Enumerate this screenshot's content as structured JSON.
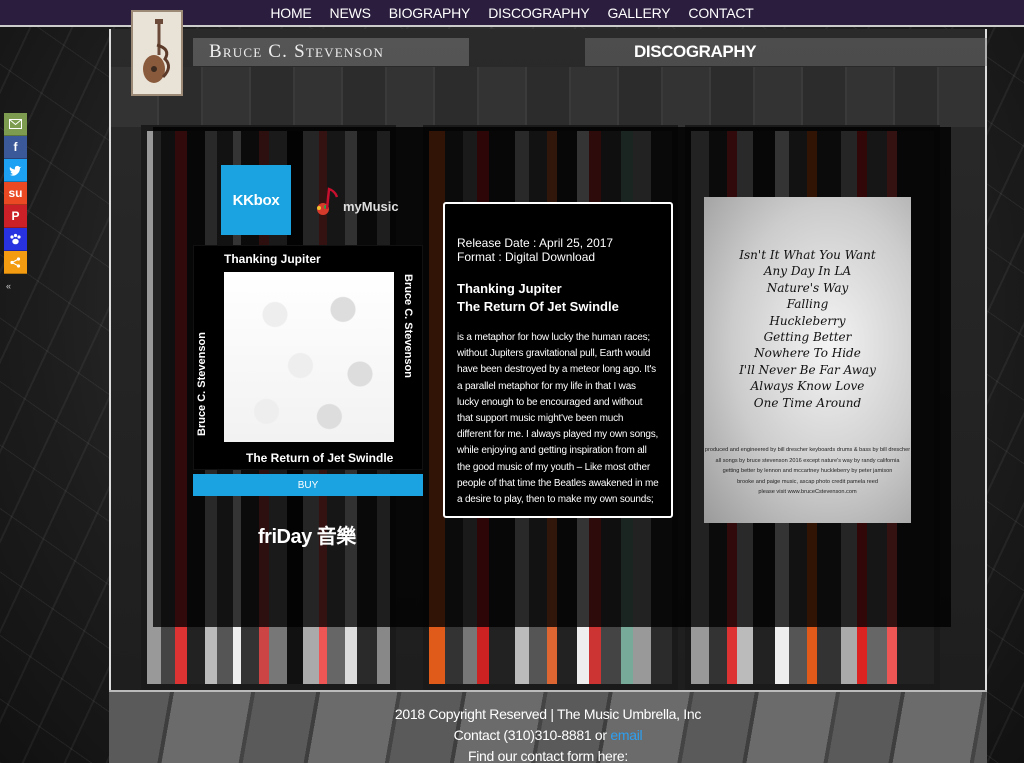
{
  "nav": {
    "items": [
      "HOME",
      "NEWS",
      "BIOGRAPHY",
      "DISCOGRAPHY",
      "GALLERY",
      "CONTACT"
    ]
  },
  "header": {
    "site_title": "Bruce C. Stevenson",
    "section_title": "DISCOGRAPHY"
  },
  "social": {
    "icons": [
      "email-icon",
      "facebook-icon",
      "twitter-icon",
      "stumbleupon-icon",
      "pinterest-icon",
      "paw-icon",
      "more-icon"
    ],
    "collapse_glyph": "«"
  },
  "left": {
    "kkbox_label": "KKbox",
    "mymusic_label": "myMusic",
    "album": {
      "title": "Thanking Jupiter",
      "subtitle": "The Return of Jet Swindle",
      "artist": "Bruce C. Stevenson"
    },
    "buy_label": "BUY",
    "friday_label": "friDay 音樂"
  },
  "info": {
    "release_date": "Release Date : April 25, 2017",
    "format": "Format : Digital Download",
    "song_1": "Thanking Jupiter",
    "song_2": "The Return Of Jet Swindle",
    "description": "is a metaphor for how lucky the human races; without Jupiters gravitational pull, Earth would have been destroyed by a meteor long ago. It's a parallel metaphor for my life in that I was lucky enough to be encouraged and without that support music might've been much different for me. I always played my own songs, while enjoying and getting inspiration from all the good music of my youth – Like most other people of that time the Beatles awakened in me a desire to play, then to make my own sounds;"
  },
  "back_cover": {
    "tracks": [
      "Isn't It What You Want",
      "Any Day In LA",
      "Nature's Way",
      "Falling",
      "Huckleberry",
      "Getting Better",
      "Nowhere To Hide",
      "I'll Never Be Far Away",
      "Always Know Love",
      "One Time Around"
    ],
    "credits": [
      "produced and engineered by bill drescher   keyboards drums & bass by bill drescher",
      "all songs by bruce stevenson   2016   except nature's way by randy california",
      "getting better by lennon and mccartney   huckleberry by peter jamison",
      "brooke and paige music, ascap   photo credit pamela reed",
      "please visit www.bruceCstevenson.com"
    ]
  },
  "footer": {
    "copyright": "2018 Copyright Reserved | The Music Umbrella, Inc",
    "contact_prefix": "Contact (310)310-8881 or ",
    "email_label": "email",
    "contact_form": "Find our contact form here:"
  },
  "colors": {
    "nav_bg": "#2b1d3d",
    "accent_blue": "#1aa3e0",
    "link_blue": "#2d9ff0"
  }
}
